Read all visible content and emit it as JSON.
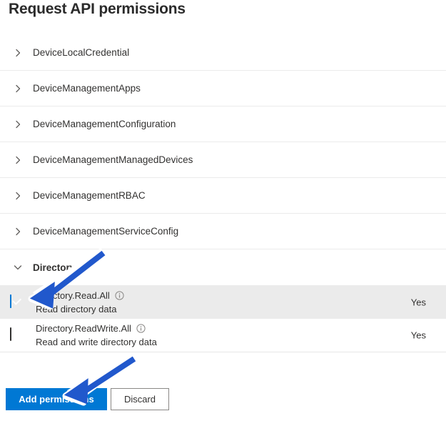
{
  "page": {
    "title": "Request API permissions"
  },
  "permission_groups": [
    {
      "name": "DeviceLocalCredential",
      "expanded": false,
      "icon": "chevron-right-icon"
    },
    {
      "name": "DeviceManagementApps",
      "expanded": false,
      "icon": "chevron-right-icon"
    },
    {
      "name": "DeviceManagementConfiguration",
      "expanded": false,
      "icon": "chevron-right-icon"
    },
    {
      "name": "DeviceManagementManagedDevices",
      "expanded": false,
      "icon": "chevron-right-icon"
    },
    {
      "name": "DeviceManagementRBAC",
      "expanded": false,
      "icon": "chevron-right-icon"
    },
    {
      "name": "DeviceManagementServiceConfig",
      "expanded": false,
      "icon": "chevron-right-icon"
    },
    {
      "name": "Directory",
      "expanded": true,
      "icon": "chevron-down-icon"
    }
  ],
  "permissions": [
    {
      "name": "Directory.Read.All",
      "description": "Read directory data",
      "admin_consent": "Yes",
      "checked": true,
      "selected": true,
      "info_icon": "info-icon"
    },
    {
      "name": "Directory.ReadWrite.All",
      "description": "Read and write directory data",
      "admin_consent": "Yes",
      "checked": false,
      "selected": false,
      "info_icon": "info-icon"
    }
  ],
  "footer": {
    "add_label": "Add permissions",
    "discard_label": "Discard"
  },
  "annotations": [
    {
      "name": "arrow-to-checkbox",
      "target": "Directory.Read.All checkbox"
    },
    {
      "name": "arrow-to-add-permissions",
      "target": "Add permissions button"
    }
  ],
  "colors": {
    "accent": "#0078d4",
    "annotation_arrow": "#2158cc",
    "row_selected": "#ebebeb",
    "divider": "#ebebeb",
    "text": "#323130"
  }
}
